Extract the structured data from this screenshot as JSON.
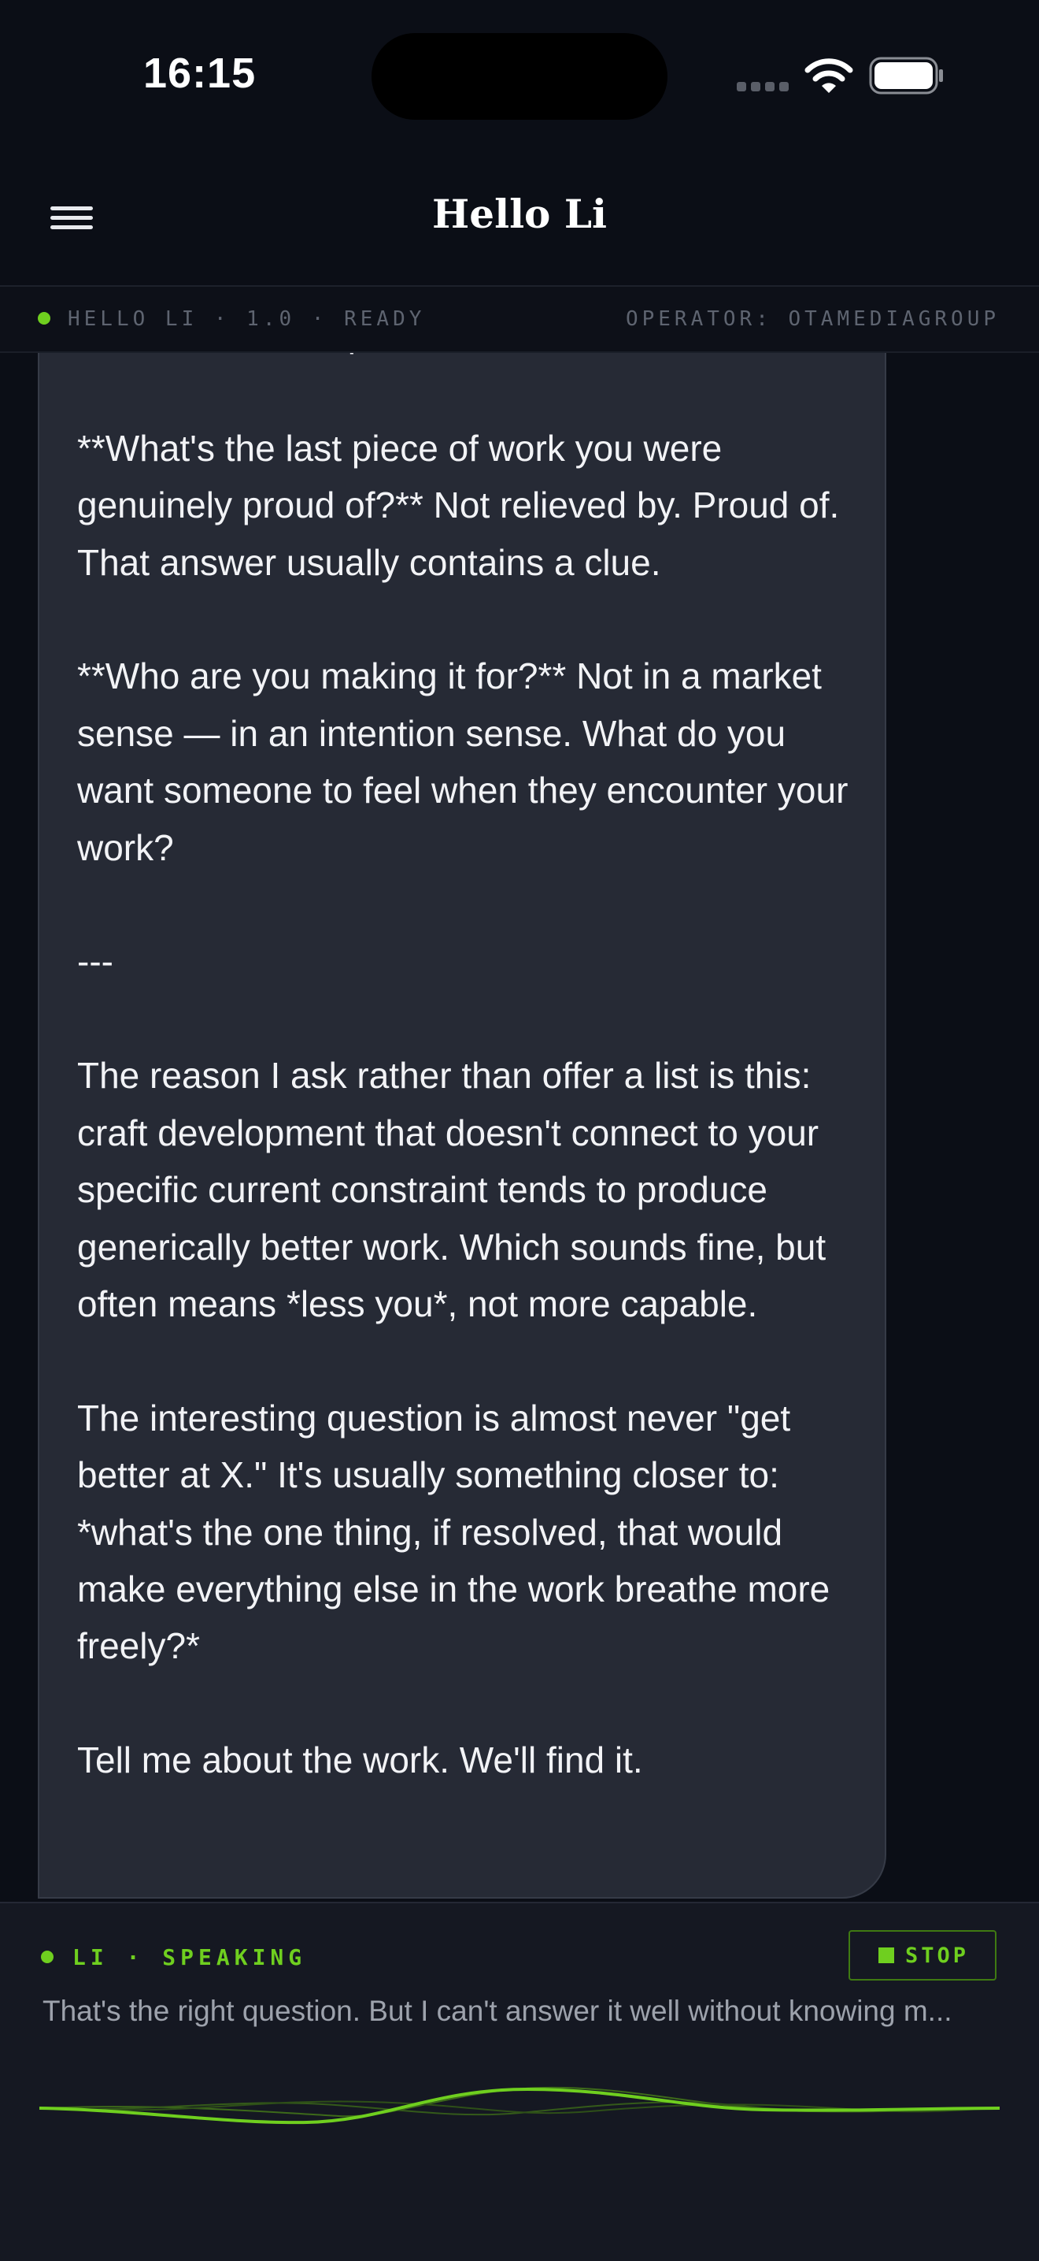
{
  "status_bar": {
    "time": "16:15"
  },
  "nav": {
    "title": "Hello Li"
  },
  "info_strip": {
    "left": "HELLO LI · 1.0 · READY",
    "right": "OPERATOR: OTAMEDIAGROUP"
  },
  "message": {
    "text": "inert. What's the persistent friction?\n\n**What's the last piece of work you were genuinely proud of?** Not relieved by. Proud of. That answer usually contains a clue.\n\n**Who are you making it for?** Not in a market sense — in an intention sense. What do you want someone to feel when they encounter your work?\n\n---\n\nThe reason I ask rather than offer a list is this: craft development that doesn't connect to your specific current constraint tends to produce generically better work. Which sounds fine, but often means *less you*, not more capable.\n\nThe interesting question is almost never \"get better at X.\" It's usually something closer to: *what's the one thing, if resolved, that would make everything else in the work breathe more freely?*\n\nTell me about the work. We'll find it."
  },
  "voice": {
    "status": "LI · SPEAKING",
    "stop_label": "STOP",
    "transcript": "That's the right question. But I can't answer it well without knowing m..."
  },
  "colors": {
    "accent": "#6fcf1f",
    "background": "#0b0e16",
    "bubble": "#262a35",
    "panel": "#151822"
  }
}
